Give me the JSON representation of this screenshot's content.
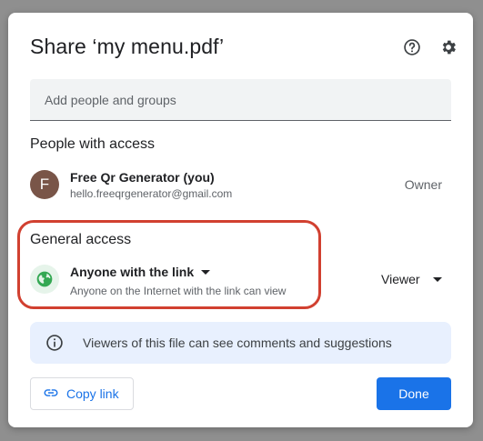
{
  "dialog": {
    "title": "Share ‘my menu.pdf’",
    "add_people_placeholder": "Add people and groups"
  },
  "people_with_access": {
    "heading": "People with access",
    "people": [
      {
        "initial": "F",
        "name": "Free Qr Generator (you)",
        "email": "hello.freeqrgenerator@gmail.com",
        "role": "Owner"
      }
    ]
  },
  "general_access": {
    "heading": "General access",
    "access_level": "Anyone with the link",
    "description": "Anyone on the Internet with the link can view",
    "role": "Viewer"
  },
  "info_banner": {
    "text": "Viewers of this file can see comments and suggestions"
  },
  "footer": {
    "copy_link_label": "Copy link",
    "done_label": "Done"
  },
  "icons": {
    "help": "help-circle-icon",
    "settings": "gear-icon",
    "access": "globe-icon",
    "info": "info-icon",
    "link": "link-icon"
  },
  "colors": {
    "accent": "#1a73e8",
    "highlight": "#d14030",
    "avatar": "#795548",
    "globe": "#34a853"
  }
}
